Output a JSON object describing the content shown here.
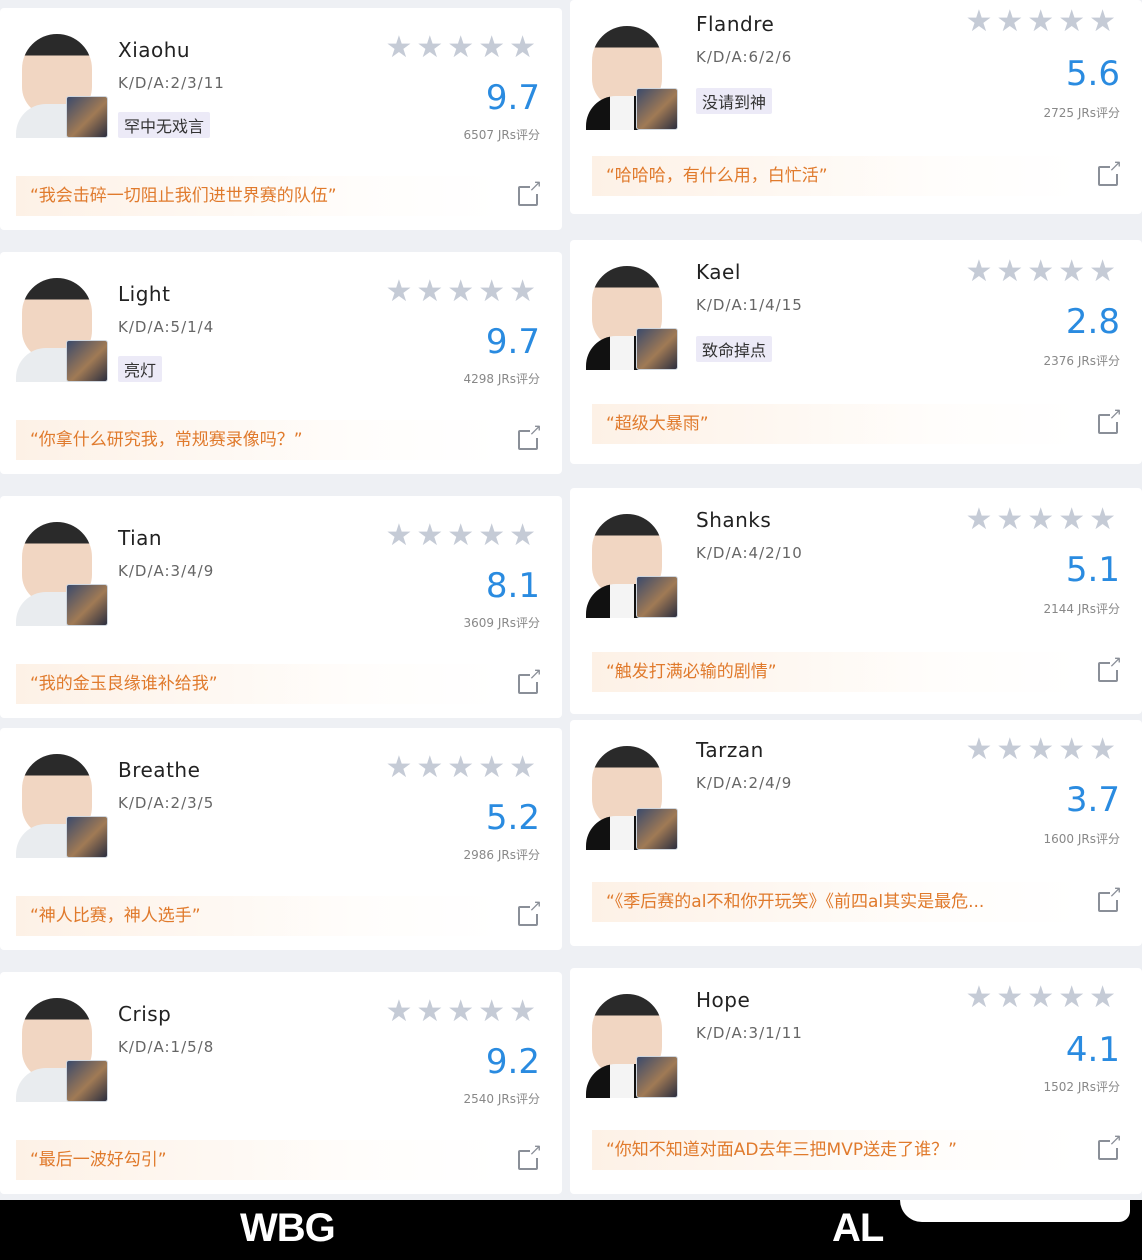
{
  "teams": {
    "left": "WBG",
    "right": "AL"
  },
  "jrs_suffix": "JRs评分",
  "left_players": [
    {
      "name": "Xiaohu",
      "kda": "K/D/A:2/3/11",
      "tag": "罕中无戏言",
      "stars": "★★★★★",
      "score": "9.7",
      "jrs": "6507 JRs评分",
      "quote": "“我会击碎一切阻止我们进世界赛的队伍”"
    },
    {
      "name": "Light",
      "kda": "K/D/A:5/1/4",
      "tag": "亮灯",
      "stars": "★★★★★",
      "score": "9.7",
      "jrs": "4298 JRs评分",
      "quote": "“你拿什么研究我，常规赛录像吗？”"
    },
    {
      "name": "Tian",
      "kda": "K/D/A:3/4/9",
      "tag": "",
      "stars": "★★★★★",
      "score": "8.1",
      "jrs": "3609 JRs评分",
      "quote": "“我的金玉良缘谁补给我”"
    },
    {
      "name": "Breathe",
      "kda": "K/D/A:2/3/5",
      "tag": "",
      "stars": "★★★★★",
      "score": "5.2",
      "jrs": "2986 JRs评分",
      "quote": "“神人比赛，神人选手”"
    },
    {
      "name": "Crisp",
      "kda": "K/D/A:1/5/8",
      "tag": "",
      "stars": "★★★★★",
      "score": "9.2",
      "jrs": "2540 JRs评分",
      "quote": "“最后一波好勾引”"
    }
  ],
  "right_players": [
    {
      "name": "Flandre",
      "kda": "K/D/A:6/2/6",
      "tag": "没请到神",
      "stars": "★★★★★",
      "score": "5.6",
      "jrs": "2725 JRs评分",
      "quote": "“哈哈哈，有什么用，白忙活”"
    },
    {
      "name": "Kael",
      "kda": "K/D/A:1/4/15",
      "tag": "致命掉点",
      "stars": "★★★★★",
      "score": "2.8",
      "jrs": "2376 JRs评分",
      "quote": "“超级大暴雨”"
    },
    {
      "name": "Shanks",
      "kda": "K/D/A:4/2/10",
      "tag": "",
      "stars": "★★★★★",
      "score": "5.1",
      "jrs": "2144 JRs评分",
      "quote": "“触发打满必输的剧情”"
    },
    {
      "name": "Tarzan",
      "kda": "K/D/A:2/4/9",
      "tag": "",
      "stars": "★★★★★",
      "score": "3.7",
      "jrs": "1600 JRs评分",
      "quote": "“《季后赛的al不和你开玩笑》《前四al其实是最危..."
    },
    {
      "name": "Hope",
      "kda": "K/D/A:3/1/11",
      "tag": "",
      "stars": "★★★★★",
      "score": "4.1",
      "jrs": "1502 JRs评分",
      "quote": "“你知不知道对面AD去年三把MVP送走了谁？”"
    }
  ]
}
